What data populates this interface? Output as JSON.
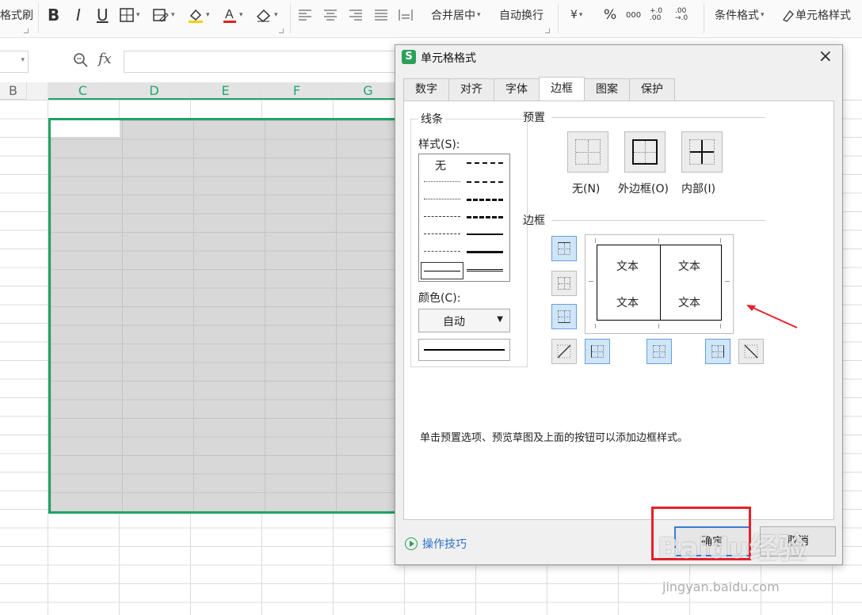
{
  "ribbon": {
    "format_painter": "格式刷",
    "bold": "B",
    "italic": "I",
    "underline": "U",
    "merge_center": "合并居中",
    "wrap_text": "自动换行",
    "currency": "¥",
    "percent": "%",
    "thousands": "000",
    "inc_decimal": "+.0 .00",
    "dec_decimal": ".00 →.0",
    "conditional_format": "条件格式",
    "cell_style": "单元格样式"
  },
  "formula_bar": {
    "fx": "fx"
  },
  "columns": [
    "B",
    "C",
    "D",
    "E",
    "F",
    "G"
  ],
  "dialog": {
    "title": "单元格格式",
    "close": "×",
    "tabs": [
      "数字",
      "对齐",
      "字体",
      "边框",
      "图案",
      "保护"
    ],
    "active_tab": "边框",
    "line_group": "线条",
    "style_label": "样式(S):",
    "style_none": "无",
    "color_label": "颜色(C):",
    "color_value": "自动",
    "preset_label": "预置",
    "presets": [
      "无(N)",
      "外边框(O)",
      "内部(I)"
    ],
    "border_label": "边框",
    "preview_text": [
      "文本",
      "文本",
      "文本",
      "文本"
    ],
    "hint": "单击预置选项、预览草图及上面的按钮可以添加边框样式。",
    "tips": "操作技巧",
    "ok": "确定",
    "cancel": "取消"
  },
  "watermark": {
    "brand": "Baidu经验",
    "url": "jingyan.baidu.com"
  },
  "colors": {
    "selection_border": "#21a366",
    "accent_blue": "#3a7bd5",
    "annotation_red": "#e8202a"
  }
}
